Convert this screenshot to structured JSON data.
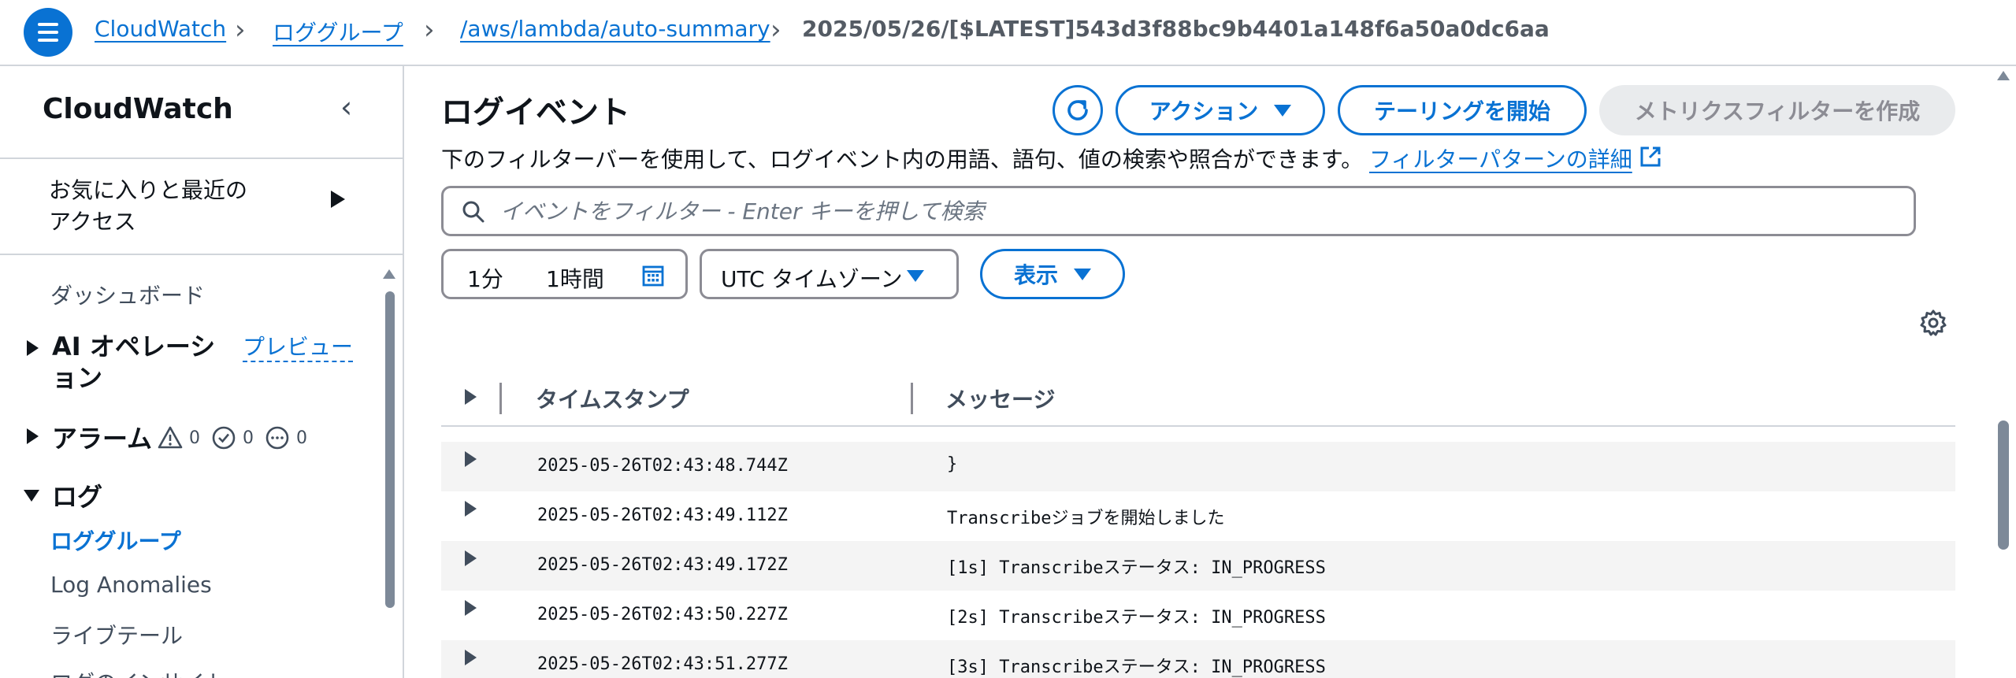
{
  "breadcrumbs": [
    {
      "label": "CloudWatch"
    },
    {
      "label": "ロググループ"
    },
    {
      "label": "/aws/lambda/auto-summary"
    },
    {
      "label": "2025/05/26/[$LATEST]543d3f88bc9b4401a148f6a50a0dc6aa"
    }
  ],
  "sidebar": {
    "title": "CloudWatch",
    "favorites_line1": "お気に入りと最近の",
    "favorites_line2": "アクセス",
    "dashboard": "ダッシュボード",
    "ai_ops_line1": "AI オペレーシ",
    "ai_ops_line2": "ョン",
    "preview_label": "プレビュー",
    "alarms": "アラーム",
    "alarm_counts": {
      "alarm": "0",
      "ok": "0",
      "insufficient": "0"
    },
    "logs": "ログ",
    "log_groups": "ロググループ",
    "log_anomalies": "Log Anomalies",
    "live_tail": "ライブテール",
    "log_insights": "ログのインサイト"
  },
  "main": {
    "title": "ログイベント",
    "description": "下のフィルターバーを使用して、ログイベント内の用語、語句、値の検索や照合ができます。",
    "filter_pattern_link": "フィルターパターンの詳細",
    "actions_label": "アクション",
    "start_tailing_label": "テーリングを開始",
    "create_metric_filter_label": "メトリクスフィルターを作成",
    "search_placeholder": "イベントをフィルター - Enter キーを押して検索",
    "range_options": [
      "1分",
      "1時間"
    ],
    "timezone_label": "UTC タイムゾーン",
    "display_label": "表示"
  },
  "table": {
    "columns": [
      "タイムスタンプ",
      "メッセージ"
    ],
    "rows": [
      {
        "timestamp": "2025-05-26T02:43:48.744Z",
        "message": "}"
      },
      {
        "timestamp": "2025-05-26T02:43:49.112Z",
        "message": "Transcribeジョブを開始しました"
      },
      {
        "timestamp": "2025-05-26T02:43:49.172Z",
        "message": "[1s] Transcribeステータス: IN_PROGRESS"
      },
      {
        "timestamp": "2025-05-26T02:43:50.227Z",
        "message": "[2s] Transcribeステータス: IN_PROGRESS"
      },
      {
        "timestamp": "2025-05-26T02:43:51.277Z",
        "message": "[3s] Transcribeステータス: IN_PROGRESS"
      }
    ]
  },
  "colors": {
    "accent": "#0972d3",
    "text": "#0f141a",
    "muted": "#414d5c",
    "border": "#8c8c94",
    "disabled_bg": "#e9ebed"
  }
}
